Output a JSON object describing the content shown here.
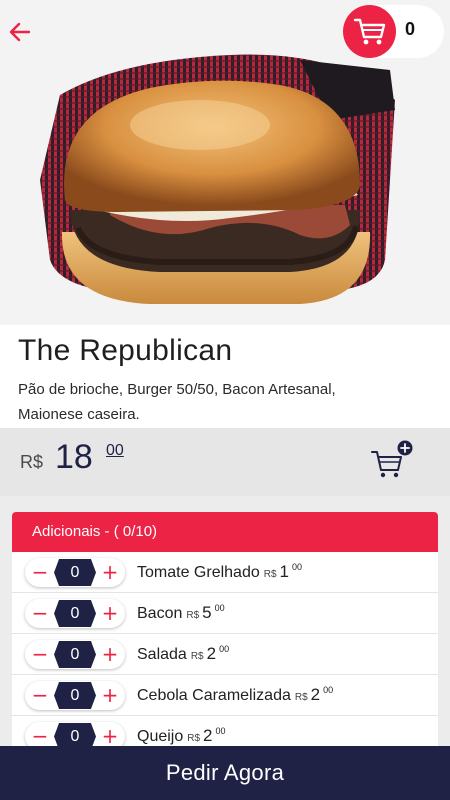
{
  "header": {
    "back_icon": "arrow-left-icon",
    "cart_icon": "shopping-cart-icon",
    "cart_count": "0",
    "accent_color": "#ec2345"
  },
  "product": {
    "title": "The Republican",
    "description_line1": "Pão de brioche, Burger 50/50, Bacon Artesanal,",
    "description_line2": "Maionese caseira.",
    "currency": "R$",
    "price_int": "18",
    "price_cents": "00",
    "add_to_cart_icon": "cart-plus-icon"
  },
  "addons": {
    "header": "Adicionais - ( 0/10)",
    "items": [
      {
        "name": "Tomate Grelhado",
        "currency": "R$",
        "price": "1",
        "cents": "00",
        "qty": "0"
      },
      {
        "name": "Bacon",
        "currency": "R$",
        "price": "5",
        "cents": "00",
        "qty": "0"
      },
      {
        "name": "Salada",
        "currency": "R$",
        "price": "2",
        "cents": "00",
        "qty": "0"
      },
      {
        "name": "Cebola Caramelizada",
        "currency": "R$",
        "price": "2",
        "cents": "00",
        "qty": "0"
      },
      {
        "name": "Queijo",
        "currency": "R$",
        "price": "2",
        "cents": "00",
        "qty": "0"
      }
    ],
    "minus_symbol": "−",
    "plus_symbol": "+"
  },
  "footer": {
    "order_label": "Pedir Agora",
    "bar_color": "#1f2245"
  }
}
